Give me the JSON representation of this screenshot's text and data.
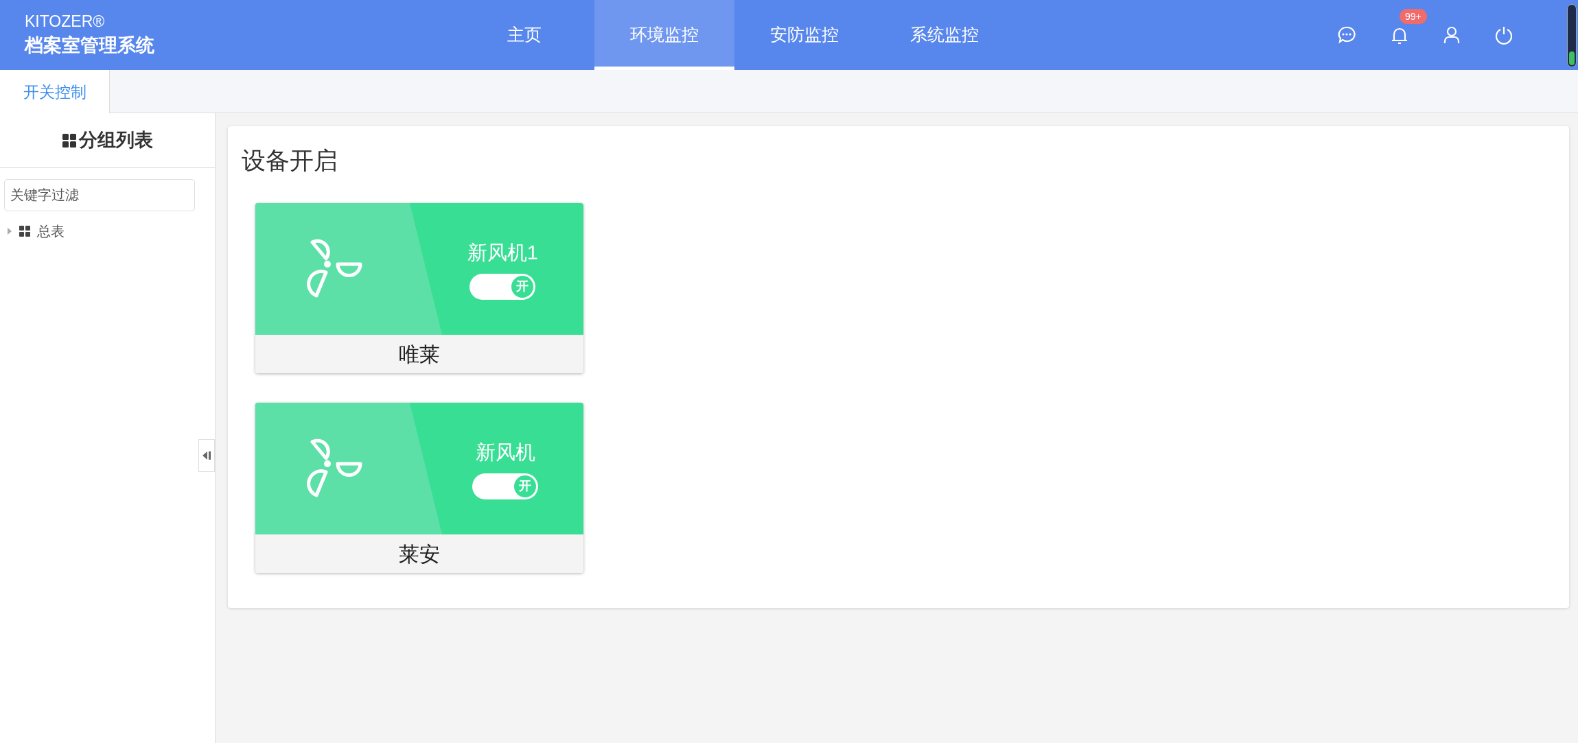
{
  "header": {
    "brand": "KITOZER®",
    "title": "档案室管理系统",
    "nav": [
      {
        "label": "主页",
        "selected": false
      },
      {
        "label": "环境监控",
        "selected": true
      },
      {
        "label": "安防监控",
        "selected": false
      },
      {
        "label": "系统监控",
        "selected": false
      }
    ],
    "notification_badge": "99+"
  },
  "tabs": [
    {
      "label": "开关控制",
      "selected": true
    }
  ],
  "sidebar": {
    "title": "分组列表",
    "filter": {
      "placeholder": "关键字过滤"
    },
    "tree": [
      {
        "label": "总表",
        "expanded": false
      }
    ]
  },
  "panel": {
    "title": "设备开启",
    "devices": [
      {
        "name": "新风机1",
        "group": "唯莱",
        "on": true,
        "switch_label": "开"
      },
      {
        "name": "新风机",
        "group": "莱安",
        "on": true,
        "switch_label": "开"
      }
    ]
  }
}
